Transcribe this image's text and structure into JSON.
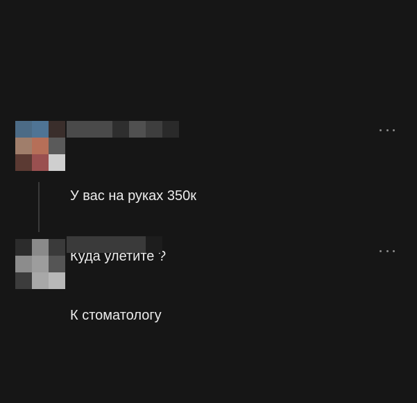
{
  "posts": [
    {
      "lines": [
        "У вас на руках 350к",
        "Куда улетите ?"
      ],
      "more_icon": "ellipsis-icon"
    },
    {
      "lines": [
        "К стоматологу"
      ],
      "more_icon": "ellipsis-icon"
    }
  ],
  "colors": {
    "background": "#161616",
    "text": "#ececec",
    "muted": "#8a8a8a",
    "connector": "#3a3a3a"
  }
}
